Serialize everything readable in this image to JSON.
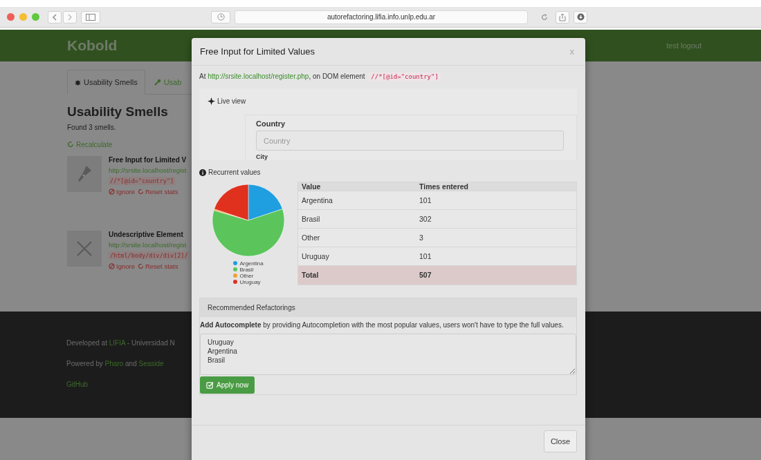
{
  "browser": {
    "url": "autorefactoring.lifia.info.unlp.edu.ar"
  },
  "navbar": {
    "brand": "Kobold",
    "user_links": "test logout"
  },
  "tabs": [
    {
      "label": "Usability Smells",
      "selected": true
    },
    {
      "label": "Usab",
      "selected": false
    }
  ],
  "page": {
    "heading": "Usability Smells",
    "found": "Found 3 smells.",
    "recalculate": "Recalculate"
  },
  "smells": [
    {
      "title": "Free Input for Limited V",
      "url": "http://srsite.localhost/regist",
      "xpath": "//*[@id=\"country\"]",
      "ignore": "Ignore",
      "reset": "Reset stats"
    },
    {
      "title": "Undescriptive Element",
      "url": "http://srsite.localhost/regist",
      "xpath": "/html/body/div/div[2]/",
      "ignore": "Ignore",
      "reset": "Reset stats"
    }
  ],
  "footer": [
    {
      "parts": [
        {
          "text": "Developed at ",
          "link": false
        },
        {
          "text": "LIFIA",
          "link": true
        },
        {
          "text": " - Universidad N",
          "link": false
        }
      ]
    },
    {
      "parts": [
        {
          "text": "Powered by ",
          "link": false
        },
        {
          "text": "Pharo",
          "link": true
        },
        {
          "text": " and ",
          "link": false
        },
        {
          "text": "Seaside",
          "link": true
        }
      ]
    },
    {
      "parts": [
        {
          "text": "GitHub",
          "link": true
        }
      ]
    }
  ],
  "modal": {
    "title": "Free Input for Limited Values",
    "close_x": "x",
    "location": {
      "prefix": "At ",
      "url": "http://srsite.localhost/register.php",
      "middle": ", on DOM element ",
      "xpath": "//*[@id=\"country\"]"
    },
    "live_view": {
      "title": "Live view",
      "field_label": "Country",
      "placeholder": "Country",
      "next_label": "City"
    },
    "recurrent": {
      "title": "Recurrent values",
      "chart_data": {
        "type": "pie",
        "categories": [
          "Argentina",
          "Brasil",
          "Other",
          "Uruguay"
        ],
        "values": [
          19.9,
          59.6,
          0.6,
          19.9
        ],
        "colors": [
          "#1f9ee0",
          "#5bc55b",
          "#f0a030",
          "#e0301e"
        ],
        "legend": "bottom"
      },
      "columns": [
        "Value",
        "Times entered"
      ],
      "rows": [
        {
          "value": "Argentina",
          "times": "101"
        },
        {
          "value": "Brasil",
          "times": "302"
        },
        {
          "value": "Other",
          "times": "3"
        },
        {
          "value": "Uruguay",
          "times": "101"
        }
      ],
      "total": {
        "value": "Total",
        "times": "507"
      }
    },
    "refactorings": {
      "title": "Recommended Refactorings",
      "description": "**Add Autocomplete** by providing Autocompletion with the most popular values, users won't have to type the full values.",
      "values": "Uruguay\nArgentina\nBrasil",
      "apply": "Apply now"
    },
    "close": "Close"
  }
}
